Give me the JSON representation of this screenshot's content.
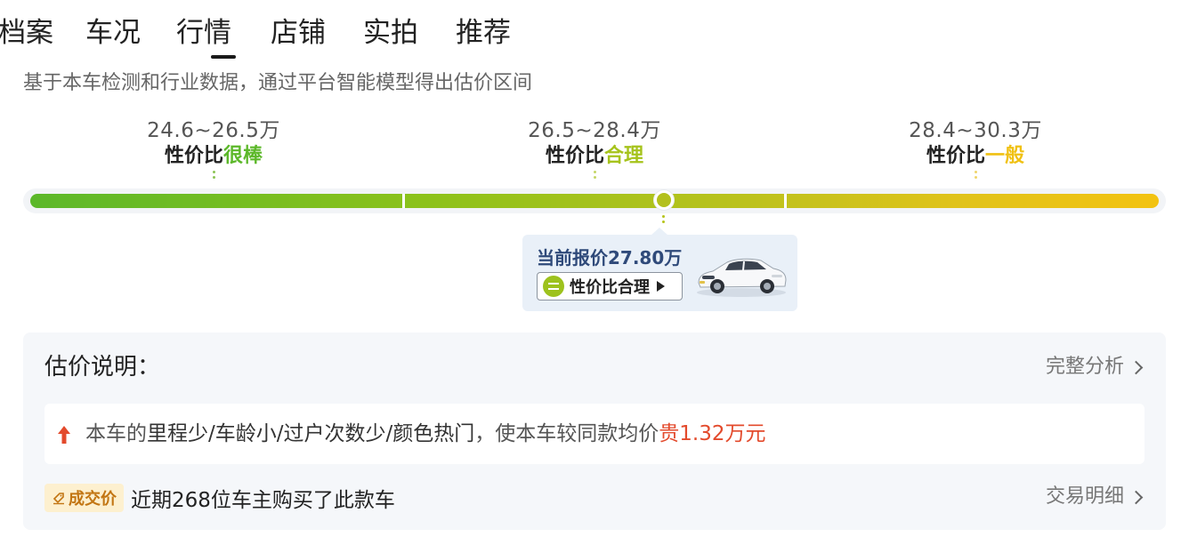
{
  "tabs": [
    {
      "label": "档案",
      "active": false
    },
    {
      "label": "车况",
      "active": false
    },
    {
      "label": "行情",
      "active": true
    },
    {
      "label": "店铺",
      "active": false
    },
    {
      "label": "实拍",
      "active": false
    },
    {
      "label": "推荐",
      "active": false
    }
  ],
  "subtitle": "基于本车检测和行业数据，通过平台智能模型得出估价区间",
  "ranges": [
    {
      "price": "24.6~26.5万",
      "rating_prefix": "性价比",
      "rating": "很棒",
      "color": "#5cb82a"
    },
    {
      "price": "26.5~28.4万",
      "rating_prefix": "性价比",
      "rating": "合理",
      "color": "#a6c31c"
    },
    {
      "price": "28.4~30.3万",
      "rating_prefix": "性价比",
      "rating": "一般",
      "color": "#f0c113"
    }
  ],
  "current": {
    "label": "当前报价27.80万",
    "rating_label": "性价比合理",
    "range_min": 24.6,
    "range_max": 30.3,
    "value": 27.8
  },
  "analysis": {
    "title": "估价说明：",
    "full_link": "完整分析",
    "reason_prefix": "本车的",
    "reason_factors": "里程少/车龄小/过户次数少/颜色热门",
    "reason_mid": "，使本车较同款均价",
    "reason_result": "贵1.32万元",
    "deal_badge": "成交价",
    "deal_text": "近期268位车主购买了此款车",
    "detail_link": "交易明细"
  },
  "colors": {
    "good": "#5cb82a",
    "fair": "#a6c31c",
    "average": "#f0c113",
    "price_up": "#e34a2c",
    "badge_text": "#c27512",
    "badge_bg": "#fdf0cf"
  }
}
